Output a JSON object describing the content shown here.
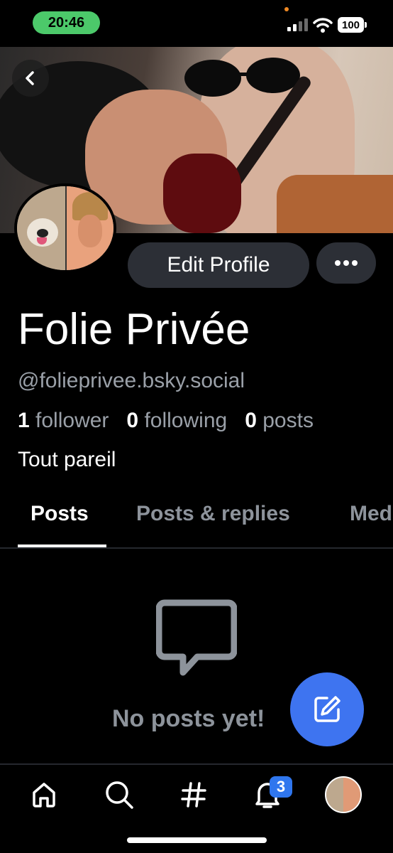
{
  "status_bar": {
    "time": "20:46",
    "battery": "100"
  },
  "profile": {
    "edit_label": "Edit Profile",
    "display_name": "Folie Privée",
    "handle": "@folieprivee.bsky.social",
    "stats": {
      "followers_count": "1",
      "followers_label": "follower",
      "following_count": "0",
      "following_label": "following",
      "posts_count": "0",
      "posts_label": "posts"
    },
    "bio": "Tout pareil"
  },
  "tabs": [
    {
      "label": "Posts",
      "selected": true
    },
    {
      "label": "Posts & replies",
      "selected": false
    },
    {
      "label": "Med",
      "selected": false
    }
  ],
  "empty_state": {
    "message": "No posts yet!",
    "icon": "message-bubble-icon"
  },
  "bottom_nav": {
    "items": [
      "home-icon",
      "search-icon",
      "hashtag-icon",
      "bell-icon",
      "avatar"
    ],
    "notification_count": "3"
  },
  "colors": {
    "accent": "#3e74f0",
    "badge": "#2f76ee",
    "muted_text": "#9aa0a8",
    "button_bg": "#2c2f36"
  }
}
